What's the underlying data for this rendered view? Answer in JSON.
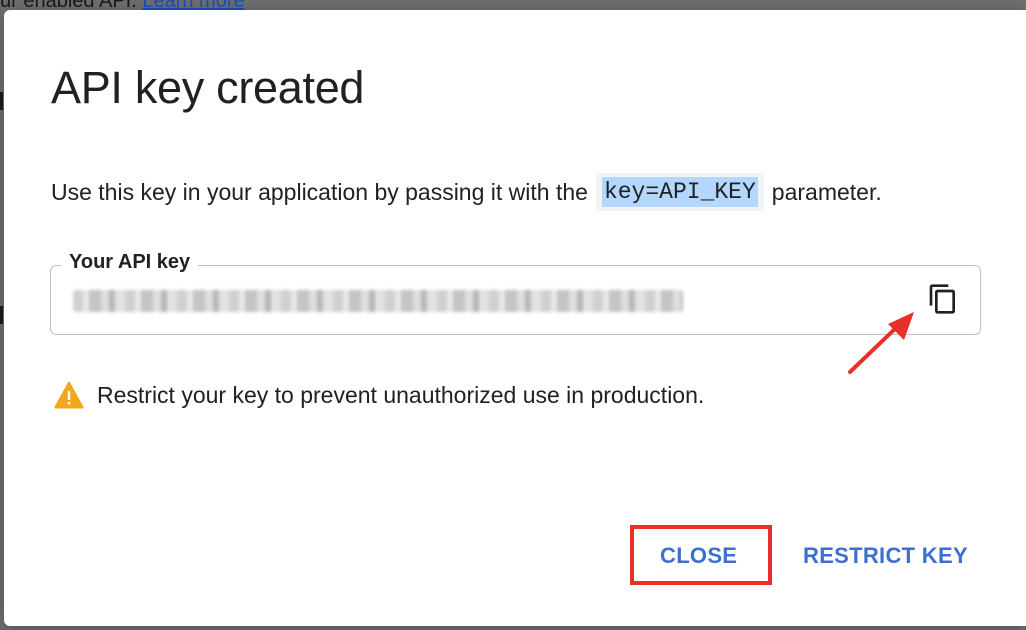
{
  "backdrop": {
    "text_prefix": "ur enabled API.",
    "link": "Learn more"
  },
  "dialog": {
    "title": "API key created",
    "description": {
      "before": "Use this key in your application by passing it with the",
      "code": "key=API_KEY",
      "after": "parameter."
    },
    "key_field": {
      "label": "Your API key",
      "value": "••••••••••••••••••••••••••••••••••••••",
      "copy_icon": "copy-icon"
    },
    "warning": {
      "icon": "warning-icon",
      "text": "Restrict your key to prevent unauthorized use in production."
    },
    "actions": {
      "close_label": "CLOSE",
      "restrict_label": "RESTRICT KEY"
    }
  },
  "annotations": {
    "arrow_color": "#e8302a",
    "highlight_color": "#e8302a"
  },
  "colors": {
    "accent": "#3c6fd0",
    "warning": "#f4a61d"
  }
}
